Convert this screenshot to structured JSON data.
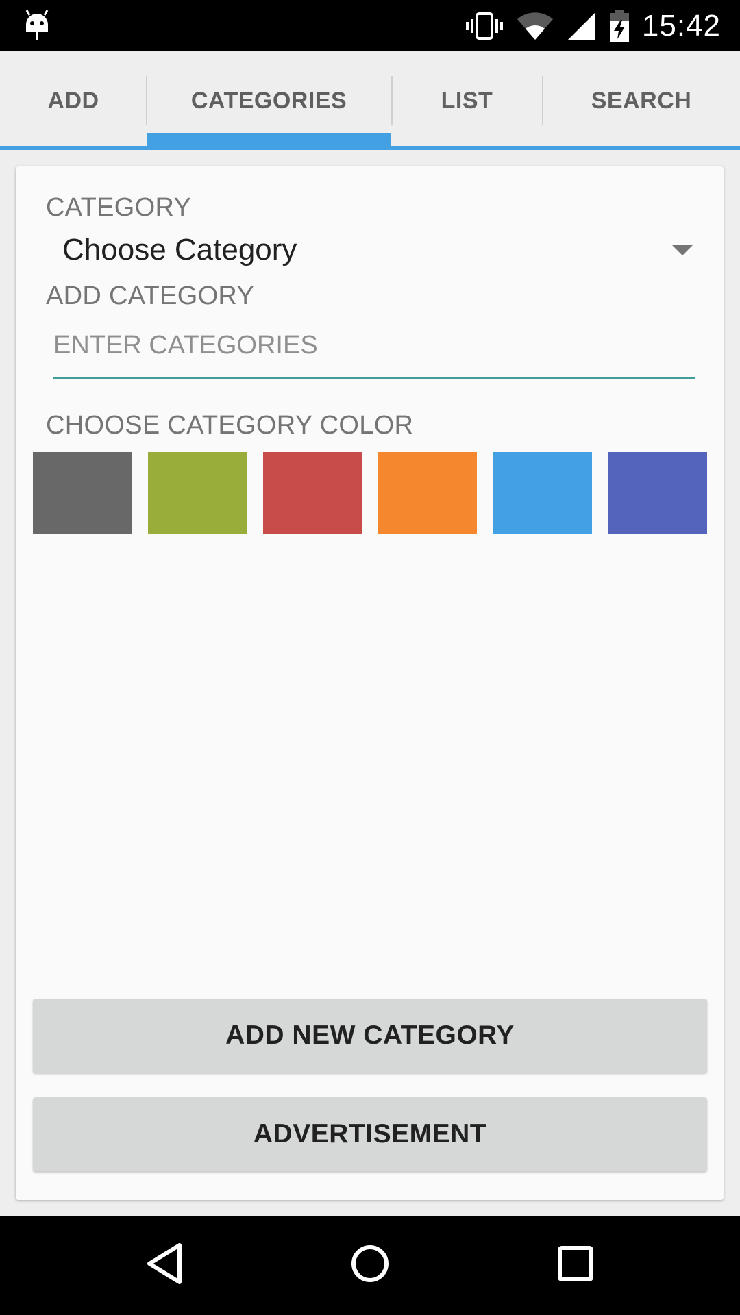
{
  "status_bar": {
    "time": "15:42",
    "icons": [
      "android-debug-icon",
      "vibrate-icon",
      "wifi-icon",
      "cell-signal-icon",
      "battery-charging-icon"
    ]
  },
  "tabs": [
    {
      "label": "ADD",
      "active": false
    },
    {
      "label": "CATEGORIES",
      "active": true
    },
    {
      "label": "LIST",
      "active": false
    },
    {
      "label": "SEARCH",
      "active": false
    }
  ],
  "form": {
    "category_label": "CATEGORY",
    "category_selected": "Choose Category",
    "add_category_label": "ADD CATEGORY",
    "add_category_placeholder": "ENTER CATEGORIES",
    "color_label": "CHOOSE CATEGORY COLOR",
    "colors": [
      "#686868",
      "#98ad3a",
      "#c84c4a",
      "#f5882f",
      "#42a0e3",
      "#5463bc"
    ]
  },
  "buttons": {
    "add_new": "ADD NEW CATEGORY",
    "advertisement": "ADVERTISEMENT"
  },
  "nav_bar": {
    "icons": [
      "back-icon",
      "home-icon",
      "recents-icon"
    ]
  },
  "theme": {
    "accent": "#42a0e3",
    "input_underline": "#3f9e9a"
  }
}
